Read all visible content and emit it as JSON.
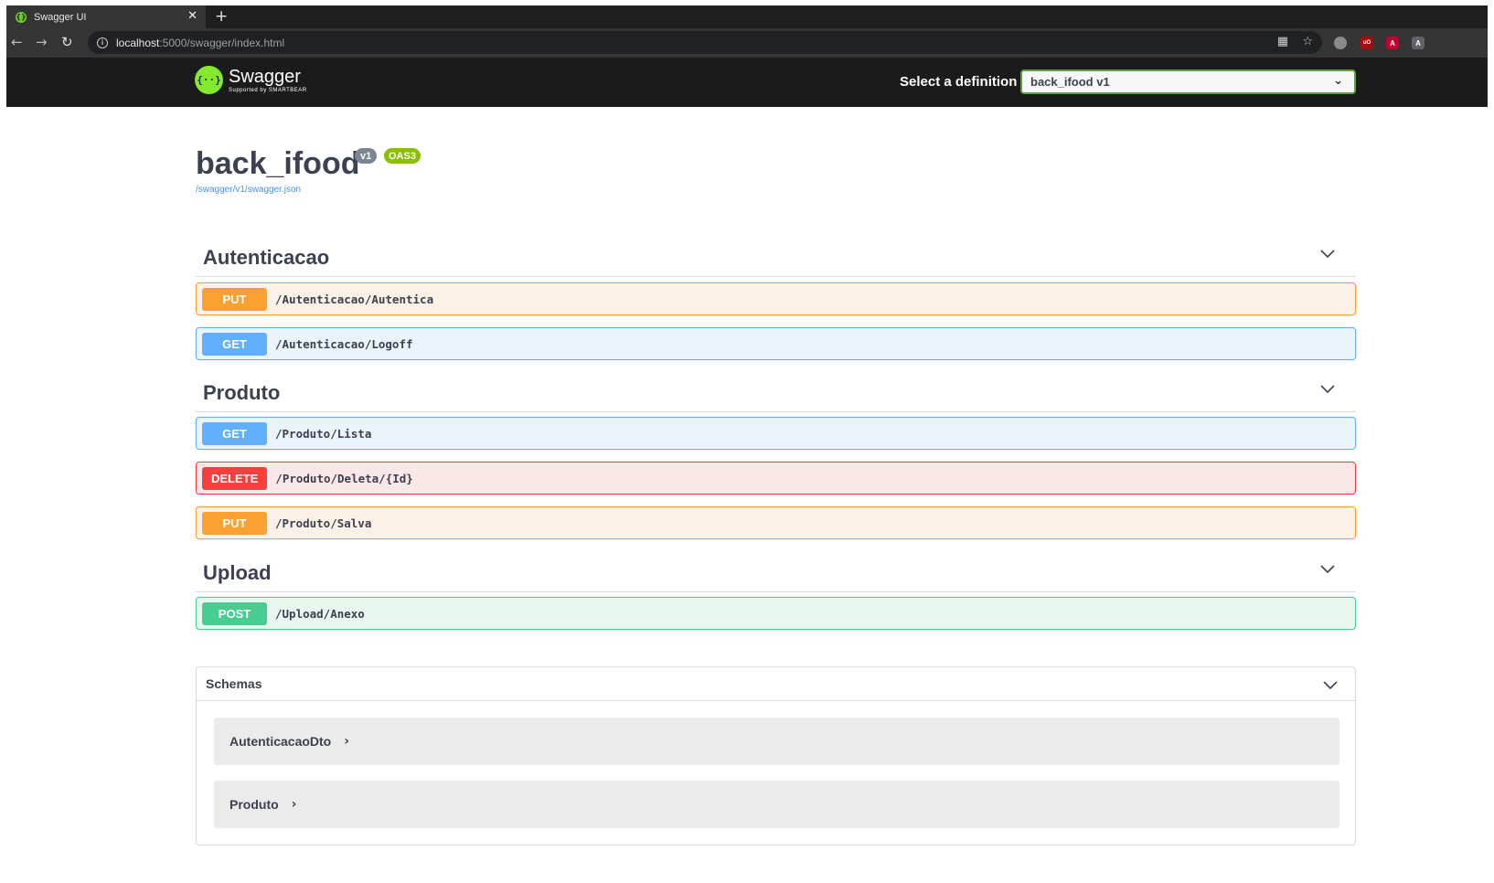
{
  "browser": {
    "tab_title": "Swagger UI",
    "tab_close": "✕",
    "new_tab": "+",
    "url_host": "localhost",
    "url_rest": ":5000/swagger/index.html"
  },
  "topbar": {
    "logo_name": "Swagger",
    "logo_sub": "Supported by SMARTBEAR",
    "select_label": "Select a definition",
    "selected_definition": "back_ifood v1"
  },
  "info": {
    "title": "back_ifood",
    "version_badge": "v1",
    "oas_badge": "OAS3",
    "spec_link": "/swagger/v1/swagger.json"
  },
  "tags": [
    {
      "name": "Autenticacao",
      "operations": [
        {
          "method": "PUT",
          "path": "/Autenticacao/Autentica"
        },
        {
          "method": "GET",
          "path": "/Autenticacao/Logoff"
        }
      ]
    },
    {
      "name": "Produto",
      "operations": [
        {
          "method": "GET",
          "path": "/Produto/Lista"
        },
        {
          "method": "DELETE",
          "path": "/Produto/Deleta/{Id}"
        },
        {
          "method": "PUT",
          "path": "/Produto/Salva"
        }
      ]
    },
    {
      "name": "Upload",
      "operations": [
        {
          "method": "POST",
          "path": "/Upload/Anexo"
        }
      ]
    }
  ],
  "schemas": {
    "title": "Schemas",
    "items": [
      "AutenticacaoDto",
      "Produto"
    ]
  },
  "colors": {
    "put": "#fca130",
    "get": "#61affe",
    "delete": "#f93e3e",
    "post": "#49cc90",
    "topbar": "#1b1b1b"
  }
}
